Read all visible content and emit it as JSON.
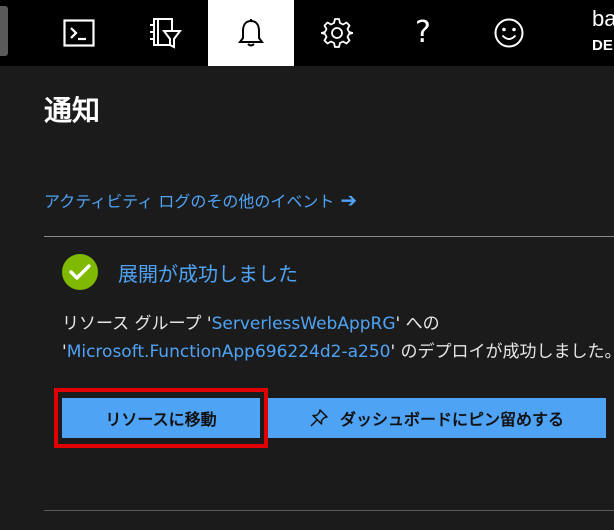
{
  "topbar": {
    "buttons": [
      {
        "icon": "cloud-shell-icon"
      },
      {
        "icon": "directory-filter-icon"
      },
      {
        "icon": "bell-icon",
        "active": true
      },
      {
        "icon": "gear-icon"
      },
      {
        "icon": "help-icon",
        "glyph": "?"
      },
      {
        "icon": "smiley-feedback-icon"
      }
    ],
    "account": {
      "name": "ba",
      "directory": "DE"
    },
    "active_bg": "#ffffff",
    "bg": "#000000"
  },
  "panel": {
    "title": "通知",
    "activity_link": "アクティビティ ログのその他のイベント",
    "notification": {
      "title": "展開が成功しました",
      "body_prefix": "リソース グループ '",
      "resource_group": "ServerlessWebAppRG",
      "body_mid": "' への",
      "deployment_prefix": "'",
      "deployment": "Microsoft.FunctionApp696224d2-a250",
      "body_suffix": "' のデプロイが成功しました。",
      "status_color": "#7fba00"
    },
    "buttons": {
      "go_to_resource": "リソースに移動",
      "pin_to_dashboard": "ダッシュボードにピン留めする"
    }
  },
  "colors": {
    "link": "#4fa3f5",
    "button_bg": "#4fa3f5",
    "highlight": "#e00000",
    "panel_bg": "#1b1b1b"
  }
}
